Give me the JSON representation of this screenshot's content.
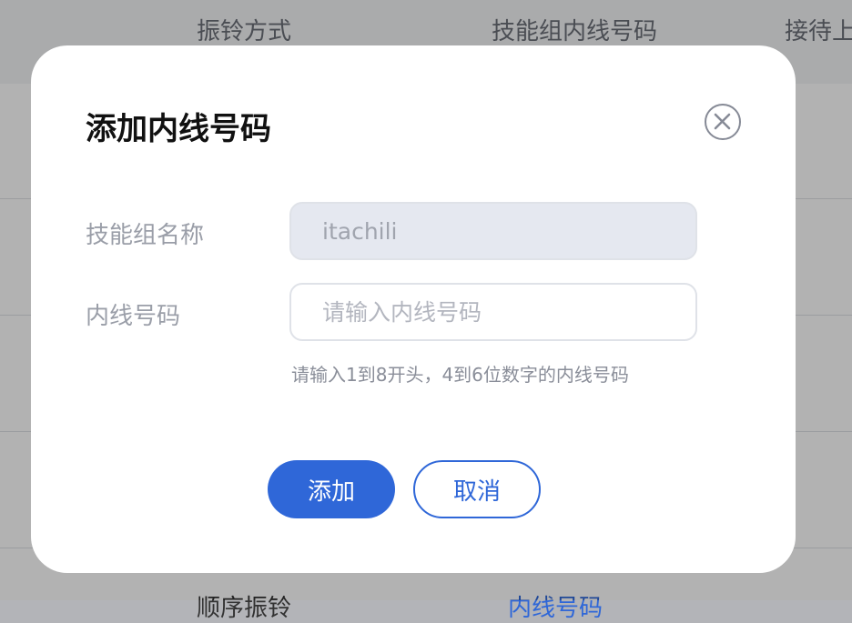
{
  "background_table": {
    "headers": [
      "振铃方式",
      "技能组内线号码",
      "接待上"
    ],
    "partial_row": [
      "顺序振铃",
      "内线号码"
    ]
  },
  "dialog": {
    "title": "添加内线号码",
    "close_icon": "close-circle-icon",
    "fields": [
      {
        "label": "技能组名称",
        "value": "itachili",
        "disabled": true
      },
      {
        "label": "内线号码",
        "value": "",
        "placeholder": "请输入内线号码"
      }
    ],
    "hint": "请输入1到8开头，4到6位数字的内线号码",
    "buttons": {
      "confirm": "添加",
      "cancel": "取消"
    }
  },
  "colors": {
    "primary": "#2f67d8",
    "overlay": "rgba(0,0,0,0.30)"
  }
}
